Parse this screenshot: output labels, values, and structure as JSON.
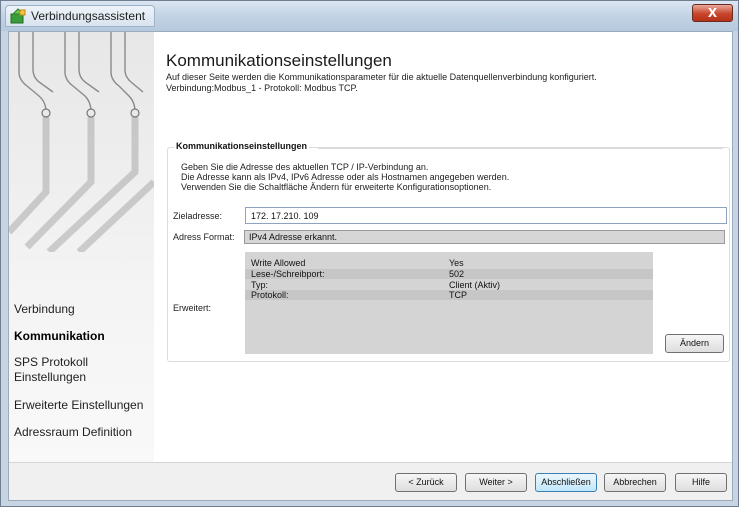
{
  "window": {
    "title": "Verbindungsassistent",
    "close_glyph": "X"
  },
  "sidebar": {
    "items": [
      {
        "label": "Verbindung",
        "active": false
      },
      {
        "label": "Kommunikation",
        "active": true
      },
      {
        "label": "SPS Protokoll\nEinstellungen",
        "active": false
      },
      {
        "label": "Erweiterte Einstellungen",
        "active": false
      },
      {
        "label": "Adressraum Definition",
        "active": false
      }
    ]
  },
  "page": {
    "title": "Kommunikationseinstellungen",
    "description_line1": "Auf dieser Seite werden die Kommunikationsparameter für die aktuelle Datenquellenverbindung konfiguriert.",
    "description_line2": "Verbindung:Modbus_1 - Protokoll: Modbus TCP."
  },
  "group": {
    "legend": "Kommunikationseinstellungen",
    "desc_line1": "Geben Sie die Adresse des aktuellen TCP / IP-Verbindung an.",
    "desc_line2": "Die Adresse kann als IPv4, IPv6 Adresse oder als Hostnamen angegeben werden.",
    "desc_line3": "Verwenden Sie die Schaltfläche Ändern für erweiterte Konfigurationsoptionen.",
    "target_label": "Zieladresse:",
    "target_value": "172. 17.210. 109",
    "format_label": "Adress Format:",
    "format_value": "IPv4 Adresse erkannt.",
    "advanced_label": "Erweitert:",
    "advanced_rows": [
      {
        "key": "Write Allowed",
        "value": "Yes"
      },
      {
        "key": "Lese-/Schreibport:",
        "value": "502"
      },
      {
        "key": "Typ:",
        "value": "Client (Aktiv)"
      },
      {
        "key": "Protokoll:",
        "value": "TCP"
      }
    ],
    "change_button": "Ändern"
  },
  "footer": {
    "back": "< Zurück",
    "next": "Weiter >",
    "finish": "Abschließen",
    "cancel": "Abbrechen",
    "help": "Hilfe"
  },
  "colors": {
    "titlebar": "#c3d3e5",
    "close": "#c8452c",
    "readonly_bg": "#d6d6d6",
    "focus_border": "#3c7fb1"
  },
  "icons": {
    "app": "wizard-hat-icon",
    "close": "close-icon"
  }
}
